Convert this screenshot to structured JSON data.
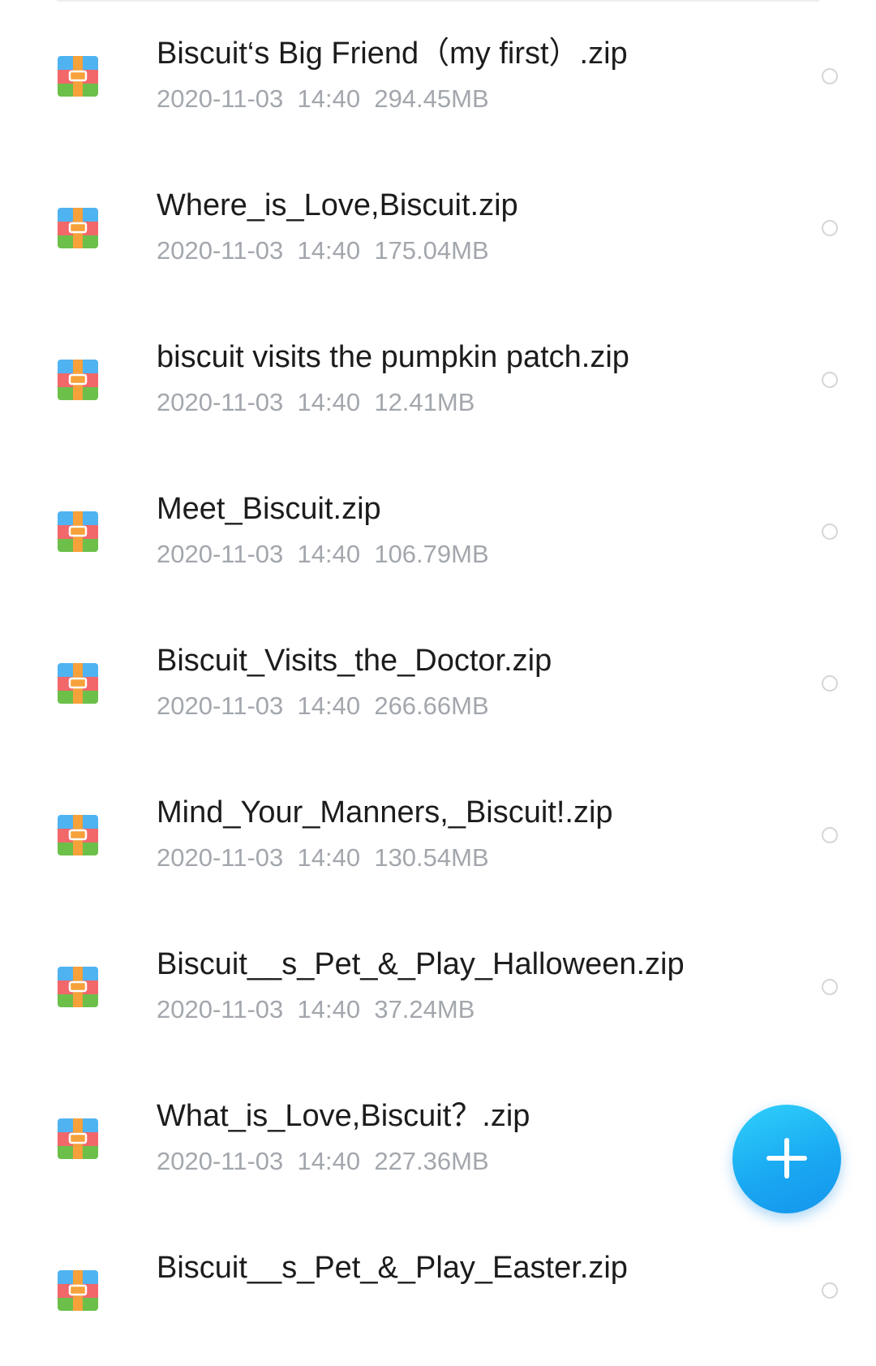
{
  "files": [
    {
      "name": "Biscuit‘s Big Friend（my first）.zip",
      "date": "2020-11-03",
      "time": "14:40",
      "size": "294.45MB",
      "icon": "zip-archive-icon"
    },
    {
      "name": "Where_is_Love,Biscuit.zip",
      "date": "2020-11-03",
      "time": "14:40",
      "size": "175.04MB",
      "icon": "zip-archive-icon"
    },
    {
      "name": "biscuit visits the pumpkin patch.zip",
      "date": "2020-11-03",
      "time": "14:40",
      "size": "12.41MB",
      "icon": "zip-archive-icon"
    },
    {
      "name": "Meet_Biscuit.zip",
      "date": "2020-11-03",
      "time": "14:40",
      "size": "106.79MB",
      "icon": "zip-archive-icon"
    },
    {
      "name": "Biscuit_Visits_the_Doctor.zip",
      "date": "2020-11-03",
      "time": "14:40",
      "size": "266.66MB",
      "icon": "zip-archive-icon"
    },
    {
      "name": "Mind_Your_Manners,_Biscuit!.zip",
      "date": "2020-11-03",
      "time": "14:40",
      "size": "130.54MB",
      "icon": "zip-archive-icon"
    },
    {
      "name": "Biscuit__s_Pet_&_Play_Halloween.zip",
      "date": "2020-11-03",
      "time": "14:40",
      "size": "37.24MB",
      "icon": "zip-archive-icon"
    },
    {
      "name": "What_is_Love,Biscuit？.zip",
      "date": "2020-11-03",
      "time": "14:40",
      "size": "227.36MB",
      "icon": "zip-archive-icon"
    },
    {
      "name": "Biscuit__s_Pet_&_Play_Easter.zip",
      "date": "",
      "time": "",
      "size": "",
      "icon": "zip-archive-icon"
    }
  ],
  "fab": {
    "icon": "plus-icon",
    "color": "#1aa9f2"
  },
  "colors": {
    "name_text": "#1c1c1c",
    "meta_text": "#a3a7ad",
    "icon_blue": "#4fb3f2",
    "icon_red": "#f2676a",
    "icon_green": "#6cc04a",
    "icon_orange": "#f6a13a"
  }
}
